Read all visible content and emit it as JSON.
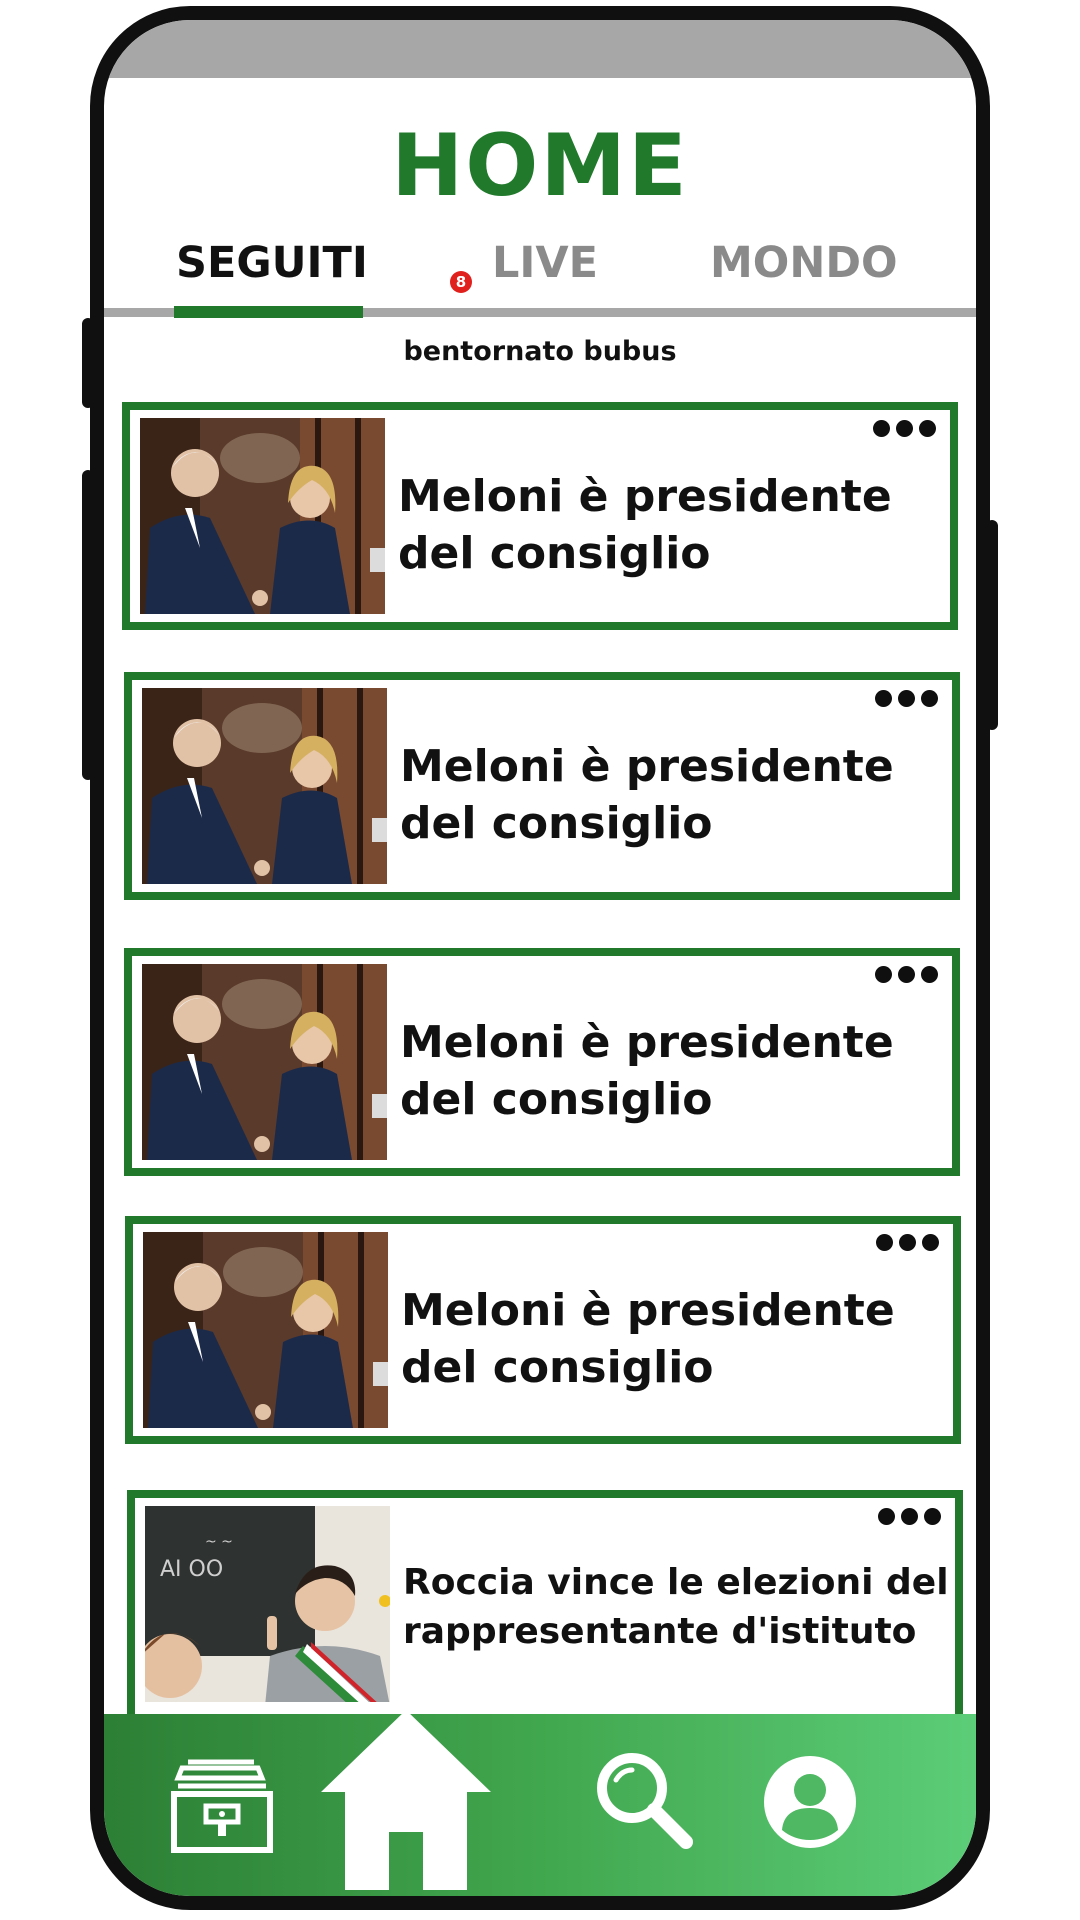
{
  "header": {
    "title": "HOME"
  },
  "tabs": [
    {
      "label": "SEGUITI",
      "active": true,
      "badge": "8"
    },
    {
      "label": "LIVE",
      "active": false
    },
    {
      "label": "MONDO",
      "active": false
    }
  ],
  "greeting": "bentornato bubus",
  "feed": [
    {
      "headline": "Meloni è presidente del consiglio",
      "image": "meloni-mattarella-handshake-photo"
    },
    {
      "headline": "Meloni è presidente del consiglio",
      "image": "meloni-mattarella-handshake-photo"
    },
    {
      "headline": "Meloni è presidente del consiglio",
      "image": "meloni-mattarella-handshake-photo"
    },
    {
      "headline": "Meloni è presidente del consiglio",
      "image": "meloni-mattarella-handshake-photo"
    },
    {
      "headline": "Roccia vince le elezioni del rappresentante d'istituto",
      "image": "student-with-sash-at-blackboard-photo"
    }
  ],
  "nav": [
    {
      "icon": "archive-icon"
    },
    {
      "icon": "home-icon"
    },
    {
      "icon": "search-icon"
    },
    {
      "icon": "profile-icon"
    }
  ],
  "colors": {
    "accent": "#217a2c",
    "nav_gradient_start": "#2c7f35",
    "nav_gradient_end": "#5ccd78",
    "tab_inactive": "#8a8a8a",
    "badge": "#e0201c",
    "status_bar": "#a7a7a7"
  }
}
